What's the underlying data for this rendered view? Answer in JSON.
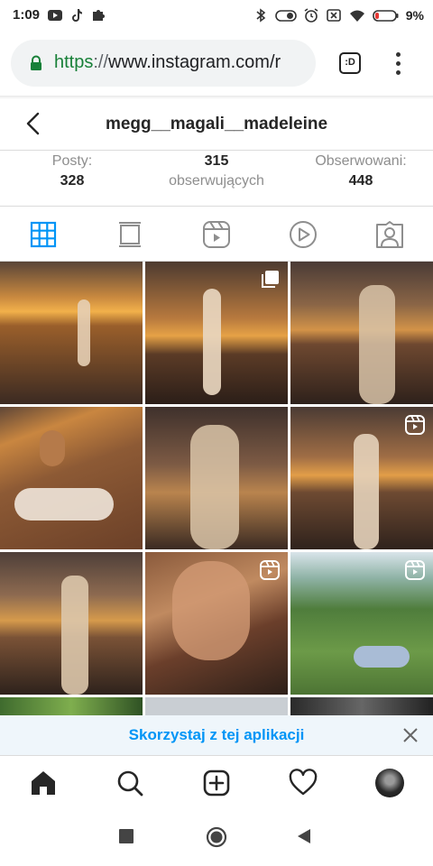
{
  "status_bar": {
    "time": "1:09",
    "battery_percent": "9%",
    "left_icons": [
      "youtube-icon",
      "tiktok-icon",
      "puzzle-icon"
    ],
    "right_icons": [
      "bluetooth-icon",
      "toggle-icon",
      "alarm-icon",
      "close-box-icon",
      "wifi-icon",
      "battery-icon"
    ]
  },
  "browser": {
    "url_scheme": "https",
    "url_separator": "://",
    "url_host": "www.instagram.com/r",
    "tab_button_label": ":D",
    "menu_icon": "vertical-dots-icon"
  },
  "profile": {
    "username": "megg__magali__madeleine",
    "stats": [
      {
        "label": "Posty:",
        "value": "328"
      },
      {
        "value": "315",
        "label": "obserwujących"
      },
      {
        "label": "Obserwowani:",
        "value": "448"
      }
    ]
  },
  "tabs": [
    "grid-icon",
    "feed-icon",
    "reels-icon",
    "video-icon",
    "tagged-icon"
  ],
  "active_tab": "grid-icon",
  "banner": {
    "text": "Skorzystaj z tej aplikacji",
    "close_icon": "close-icon"
  },
  "bottom_nav": [
    "home-icon",
    "search-icon",
    "new-post-icon",
    "heart-icon",
    "avatar"
  ],
  "colors": {
    "accent": "#0095f6",
    "url_scheme_green": "#188038",
    "lock_green": "#188038"
  }
}
